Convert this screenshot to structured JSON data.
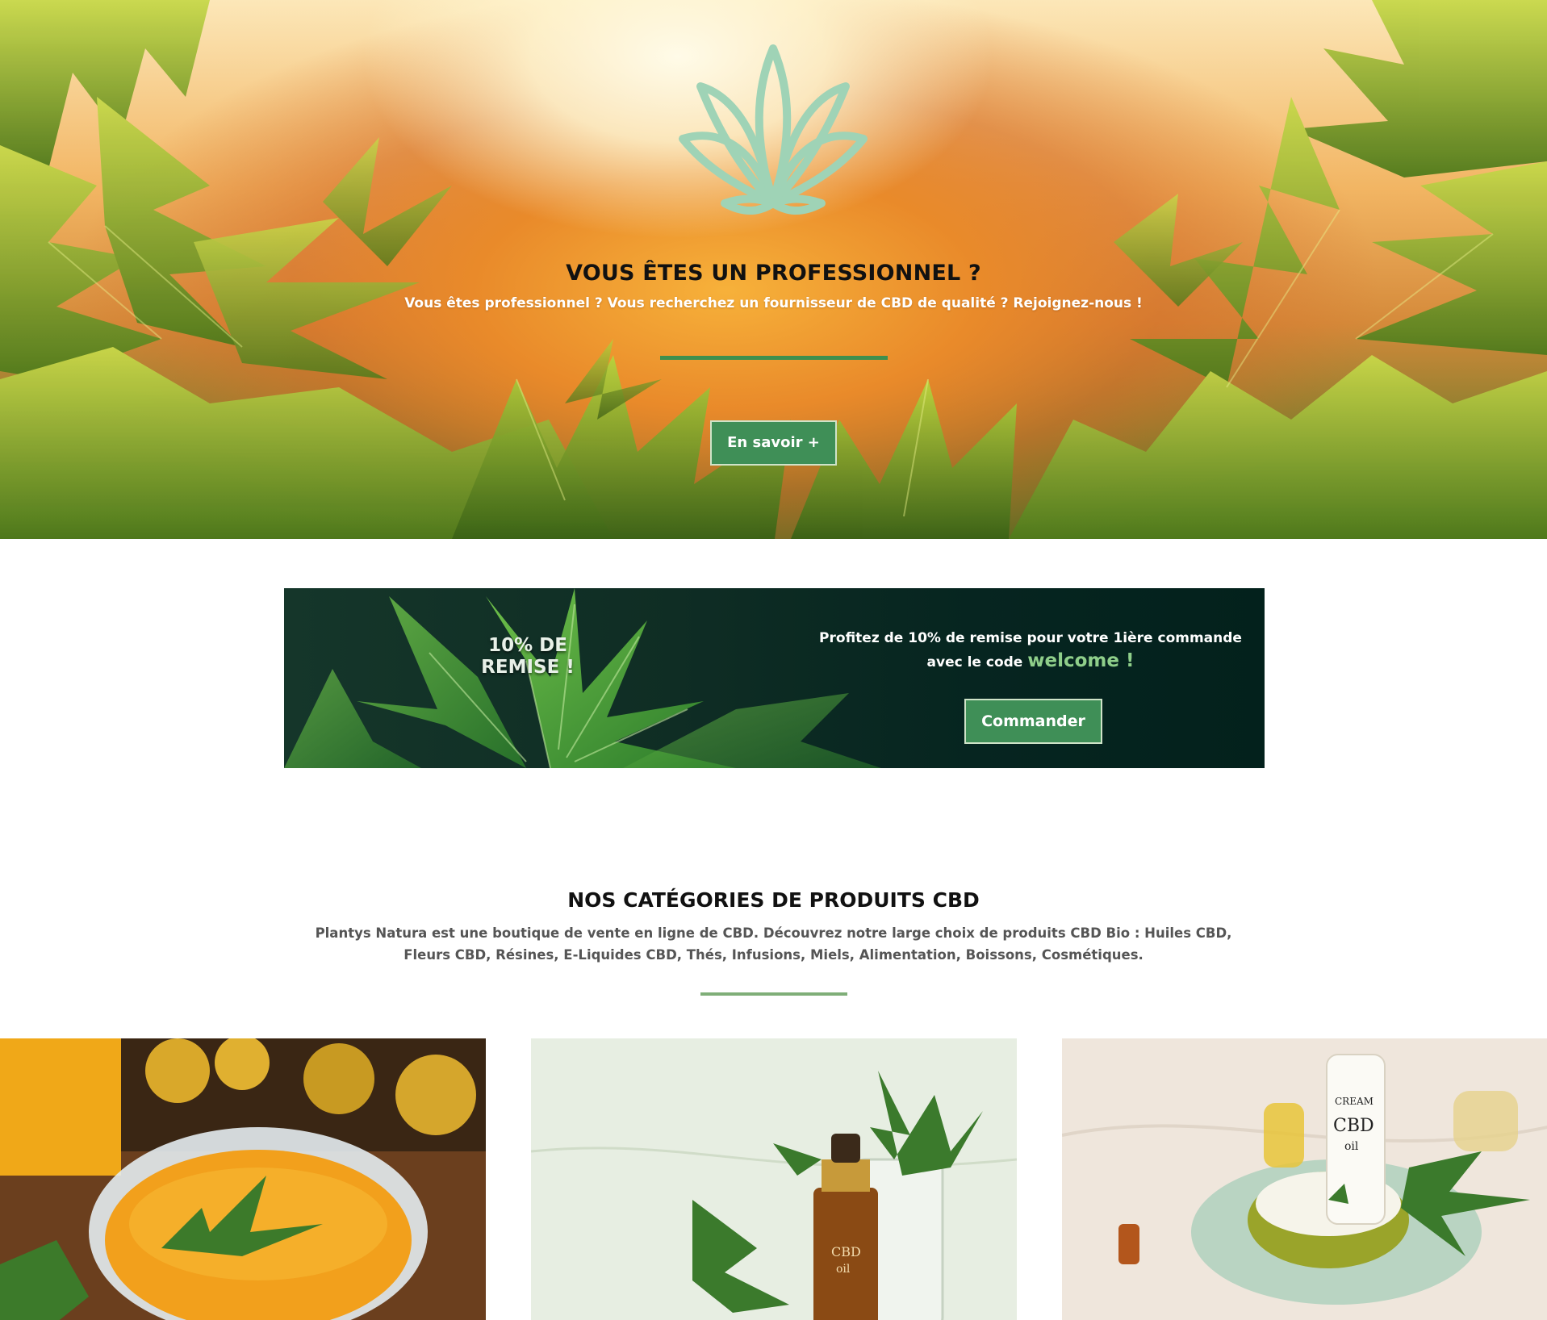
{
  "hero": {
    "title": "VOUS ÊTES UN PROFESSIONNEL ?",
    "subtitle": "Vous êtes professionnel ? Vous recherchez un fournisseur de CBD de qualité ? Rejoignez-nous !",
    "button_label": "En savoir +",
    "logo_icon": "cannabis-leaf-icon",
    "colors": {
      "accent_green": "#3f8f57",
      "logo_green": "#9fd3b6"
    }
  },
  "promo": {
    "badge": "10% DE REMISE !",
    "text": "Profitez de 10% de remise pour votre 1ière commande avec le code",
    "code": "welcome !",
    "button_label": "Commander",
    "colors": {
      "background": "#062520",
      "code": "#8fcf8a"
    }
  },
  "categories": {
    "title": "NOS CATÉGORIES DE PRODUITS CBD",
    "description": "Plantys Natura est une boutique de vente en ligne de CBD. Découvrez notre large choix de produits CBD Bio : Huiles CBD, Fleurs CBD, Résines, E-Liquides CBD,  Thés, Infusions, Miels, Alimentation, Boissons, Cosmétiques.",
    "cards": [
      {
        "image": "cbd-honey-image"
      },
      {
        "image": "cbd-oil-image"
      },
      {
        "image": "cbd-cream-image"
      }
    ]
  }
}
